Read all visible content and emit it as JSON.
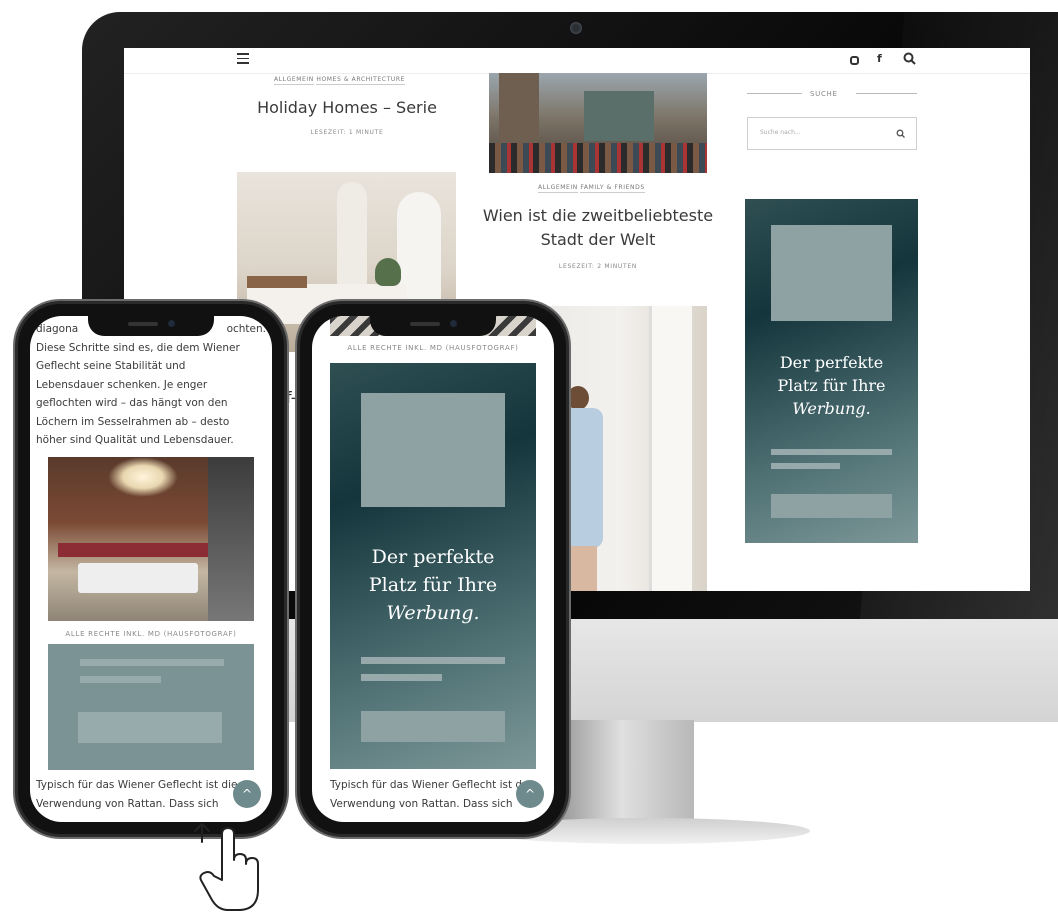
{
  "desktop": {
    "icons": [
      "menu-icon",
      "instagram-icon",
      "facebook-icon",
      "search-icon"
    ],
    "facebook_glyph": "f",
    "posts": [
      {
        "categories": [
          "ALLGEMEIN",
          "HOMES & ARCHITECTURE"
        ],
        "title": "Holiday Homes – Serie",
        "meta": "LESEZEIT: 1 MINUTE"
      },
      {
        "categories": [
          "ALLGEMEIN",
          "FAMILY & FRIENDS"
        ],
        "title_line1": "Wien ist die zweitbeliebteste",
        "title_line2": "Stadt der Welt",
        "meta": "LESEZEIT: 2 MINUTEN"
      }
    ],
    "sidebar": {
      "search_heading": "SUCHE",
      "search_placeholder": "Suche nach...",
      "ad_line1": "Der perfekte",
      "ad_line2": "Platz für Ihre",
      "ad_line3": "Werbung."
    },
    "partial_text": "f-g"
  },
  "phone_left": {
    "paragraph_lines": [
      "diagona",
      "ochten.",
      "Diese Schritte sind es, die dem Wiener",
      "Geflecht seine Stabilität und",
      "Lebensdauer schenken. Je enger",
      "geflochten wird – das hängt von den",
      "Löchern im Sesselrahmen ab – desto",
      "höher sind Qualität und Lebensdauer."
    ],
    "caption": "ALLE RECHTE INKL. MD (HAUSFOTOGRAF)",
    "footer_line1": "Typisch für das Wiener Geflecht ist die",
    "footer_line2": "Verwendung von Rattan. Dass sich",
    "scroll_icon": "^"
  },
  "phone_right": {
    "caption": "ALLE RECHTE INKL. MD (HAUSFOTOGRAF)",
    "ad_line1": "Der perfekte",
    "ad_line2": "Platz für Ihre",
    "ad_line3": "Werbung.",
    "footer_line1": "Typisch für das Wiener Geflecht ist d",
    "footer_line2": "Verwendung von Rattan. Dass sich",
    "scroll_icon": "^"
  },
  "colors": {
    "ad_dark": "#14353b",
    "ad_light": "#7d9798",
    "accent": "#6e8a8c"
  }
}
